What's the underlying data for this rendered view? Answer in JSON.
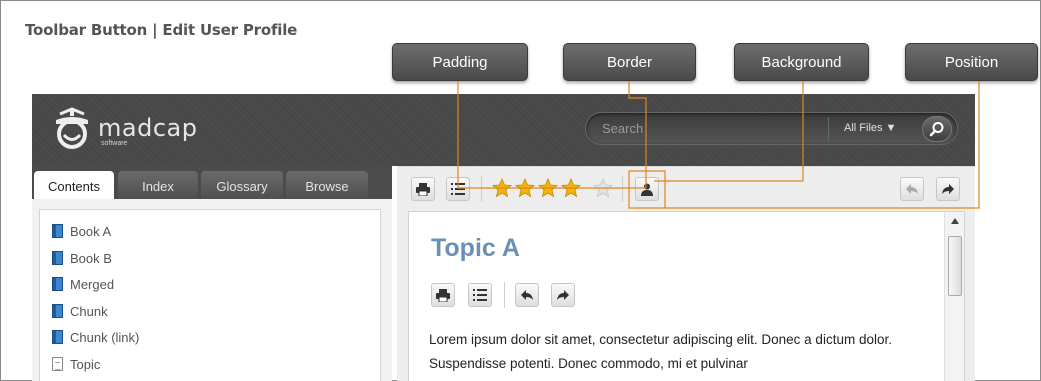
{
  "page_title": "Toolbar Button | Edit User Profile",
  "callouts": [
    "Padding",
    "Border",
    "Background",
    "Position"
  ],
  "header": {
    "logo_name": "madcap",
    "logo_sub": "software",
    "search_placeholder": "Search",
    "search_filter": "All Files ▼"
  },
  "tabs": [
    "Contents",
    "Index",
    "Glossary",
    "Browse"
  ],
  "nav_items": [
    {
      "label": "Book A",
      "icon": "book-icon"
    },
    {
      "label": "Book B",
      "icon": "book-icon"
    },
    {
      "label": "Merged",
      "icon": "book-icon"
    },
    {
      "label": "Chunk",
      "icon": "book-icon"
    },
    {
      "label": "Chunk (link)",
      "icon": "book-icon"
    },
    {
      "label": "Topic",
      "icon": "page-icon"
    }
  ],
  "content": {
    "topic_title": "Topic A",
    "body": "Lorem ipsum dolor sit amet, consectetur adipiscing elit. Donec a dictum dolor. Suspendisse potenti. Donec commodo, mi et pulvinar"
  },
  "rating": {
    "filled_stars": 4,
    "total_stars": 5
  },
  "colors": {
    "callout_bg": "#555555",
    "header_bg": "#4b4b4b",
    "leader_line": "#e2861b",
    "topic_title": "#6b90b3",
    "star": "#f2b30c"
  }
}
